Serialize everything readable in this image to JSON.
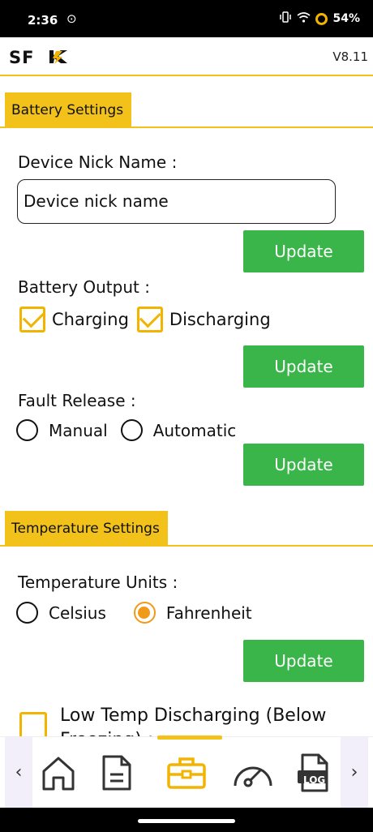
{
  "status_bar": {
    "time": "2:36",
    "battery": "54%"
  },
  "header": {
    "logo_text": "SFK",
    "version": "V8.11"
  },
  "battery_settings": {
    "section_title": "Battery Settings",
    "nick_name_label": "Device Nick Name :",
    "nick_name_value": "Device nick name",
    "update_label": "Update",
    "output_label": "Battery Output :",
    "output_options": [
      {
        "label": "Charging",
        "checked": true
      },
      {
        "label": "Discharging",
        "checked": true
      }
    ],
    "fault_label": "Fault Release :",
    "fault_options": [
      {
        "label": "Manual",
        "selected": false
      },
      {
        "label": "Automatic",
        "selected": false
      }
    ]
  },
  "temperature_settings": {
    "section_title": "Temperature Settings",
    "units_label": "Temperature Units :",
    "units_options": [
      {
        "label": "Celsius",
        "selected": false
      },
      {
        "label": "Fahrenheit",
        "selected": true
      }
    ],
    "update_label": "Update",
    "low_temp_label": "Low Temp Discharging (Below Freezing) :"
  },
  "bottom_nav": {
    "items": [
      "home-icon",
      "document-icon",
      "toolbox-icon",
      "gauge-icon",
      "log-file-icon"
    ],
    "log_label": "LOG",
    "active_index": 2
  },
  "colors": {
    "accent": "#f2c21b",
    "button": "#3ab54a",
    "radio_selected": "#f09a1a"
  }
}
